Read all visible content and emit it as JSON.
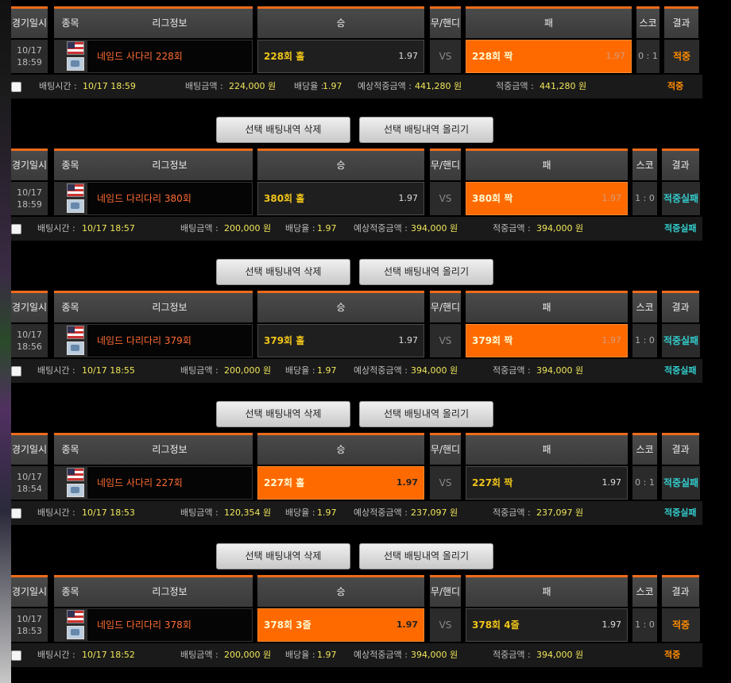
{
  "headers": {
    "date": "경기일시",
    "kind": "종목",
    "league": "리그정보",
    "win": "승",
    "draw": "무/핸디",
    "lose": "패",
    "score": "스코어",
    "result": "결과"
  },
  "labels": {
    "bet_time": "배팅시간 :",
    "bet_amount": "배팅금액 :",
    "odds": "배당율 :",
    "expected": "예상적중금액 :",
    "won": "적중금액 :",
    "vs": "VS"
  },
  "buttons": {
    "delete": "선택 배팅내역 삭제",
    "post": "선택 배팅내역 올리기"
  },
  "colors": {
    "accent": "#ee6b1a",
    "selected": "#ff6a00",
    "result_hit": "#ff8c00",
    "result_hit_special": "#33cccc"
  },
  "bets": [
    {
      "date": "10/17",
      "time": "18:59",
      "league": "네임드 사다리 228회",
      "win": "228회 홀",
      "win_odds": "1.97",
      "draw": "VS",
      "lose": "228회 짝",
      "lose_odds": "1.97",
      "selected": "lose",
      "score": "0 : 1",
      "result": "적중",
      "result_color": "#ff8c00",
      "bet_time": "10/17 18:59",
      "amount": "224,000 원",
      "odds": "1.97",
      "expected": "441,280 원",
      "won": "441,280 원",
      "footer_result": "적중"
    },
    {
      "date": "10/17",
      "time": "18:59",
      "league": "네임드 다리다리 380회",
      "win": "380회 홀",
      "win_odds": "1.97",
      "draw": "VS",
      "lose": "380회 짝",
      "lose_odds": "1.97",
      "selected": "lose",
      "score": "1 : 0",
      "result": "적중실패",
      "result_color": "#33cccc",
      "bet_time": "10/17 18:57",
      "amount": "200,000 원",
      "odds": "1.97",
      "expected": "394,000 원",
      "won": "394,000 원",
      "footer_result": "적중실패"
    },
    {
      "date": "10/17",
      "time": "18:56",
      "league": "네임드 다리다리 379회",
      "win": "379회 홀",
      "win_odds": "1.97",
      "draw": "VS",
      "lose": "379회 짝",
      "lose_odds": "1.97",
      "selected": "lose",
      "score": "1 : 0",
      "result": "적중실패",
      "result_color": "#33cccc",
      "bet_time": "10/17 18:55",
      "amount": "200,000 원",
      "odds": "1.97",
      "expected": "394,000 원",
      "won": "394,000 원",
      "footer_result": "적중실패"
    },
    {
      "date": "10/17",
      "time": "18:54",
      "league": "네임드 사다리 227회",
      "win": "227회 홀",
      "win_odds": "1.97",
      "draw": "VS",
      "lose": "227회 짝",
      "lose_odds": "1.97",
      "selected": "win",
      "score": "0 : 1",
      "result": "적중실패",
      "result_color": "#33cccc",
      "bet_time": "10/17 18:53",
      "amount": "120,354 원",
      "odds": "1.97",
      "expected": "237,097 원",
      "won": "237,097 원",
      "footer_result": "적중실패"
    },
    {
      "date": "10/17",
      "time": "18:53",
      "league": "네임드 다리다리 378회",
      "win": "378회 3줄",
      "win_odds": "1.97",
      "draw": "VS",
      "lose": "378회 4줄",
      "lose_odds": "1.97",
      "selected": "win",
      "score": "1 : 0",
      "result": "적중",
      "result_color": "#ff8c00",
      "bet_time": "10/17 18:52",
      "amount": "200,000 원",
      "odds": "1.97",
      "expected": "394,000 원",
      "won": "394,000 원",
      "footer_result": "적중"
    }
  ]
}
